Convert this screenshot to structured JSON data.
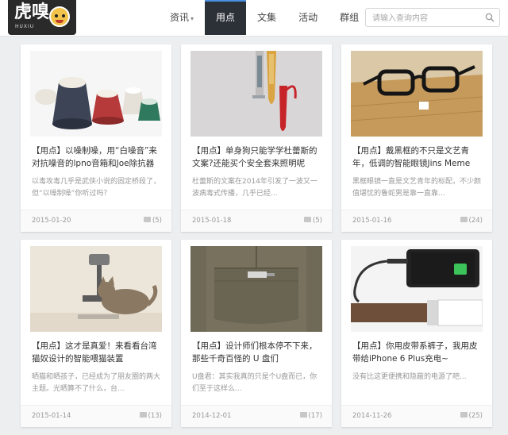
{
  "logo": {
    "text": "虎嗅",
    "sub": "HUXIU"
  },
  "nav": [
    {
      "label": "资讯",
      "caret": "▾",
      "active": false
    },
    {
      "label": "用点",
      "active": true
    },
    {
      "label": "文集",
      "active": false
    },
    {
      "label": "活动",
      "active": false
    },
    {
      "label": "群组",
      "active": false
    }
  ],
  "search": {
    "placeholder": "请输入查询内容"
  },
  "articles": [
    {
      "tag": "【用点】",
      "title": "以噪制噪，用“白噪音”来对抗噪音的lpno音箱和Joe除抗器",
      "excerpt": "以毒攻毒几乎是武侠小说的固定桥段了，但“以噪制噪”你听过吗？",
      "date": "2015-01-20",
      "comments": "(5)"
    },
    {
      "tag": "【用点】",
      "title": "单身狗只能学学杜蕾斯的文案?还能买个安全套来照明呢",
      "excerpt": "杜蕾斯的文案在2014年引发了一波又一波病毒式传播，几乎已经...",
      "date": "2015-01-18",
      "comments": "(5)"
    },
    {
      "tag": "【用点】",
      "title": "戴黑框的不只是文艺青年，低调的智能眼镜Jins Meme",
      "excerpt": "黑框眼镜一直是文艺青年的标配，不少颜值堪忧的鲁蛇男是靠一直靠...",
      "date": "2015-01-16",
      "comments": "(24)"
    },
    {
      "tag": "【用点】",
      "title": "这才是真爱！来看看台湾猫奴设计的智能喂猫装置",
      "excerpt": "晒猫和晒孩子，已经成为了朋友圈的两大主题。光晒算不了什么，台...",
      "date": "2015-01-14",
      "comments": "(13)"
    },
    {
      "tag": "【用点】",
      "title": "设计师们根本停不下来，那些千奇百怪的 U 盘们",
      "excerpt": "U盘君：其实我真的只是个U盘而已，你们至于这样么...",
      "date": "2014-12-01",
      "comments": "(17)"
    },
    {
      "tag": "【用点】",
      "title": "你用皮带系裤子，我用皮带给iPhone 6 Plus充电~",
      "excerpt": "没有比这更便携和隐蔽的电源了吧...",
      "date": "2014-11-26",
      "comments": "(25)"
    }
  ]
}
